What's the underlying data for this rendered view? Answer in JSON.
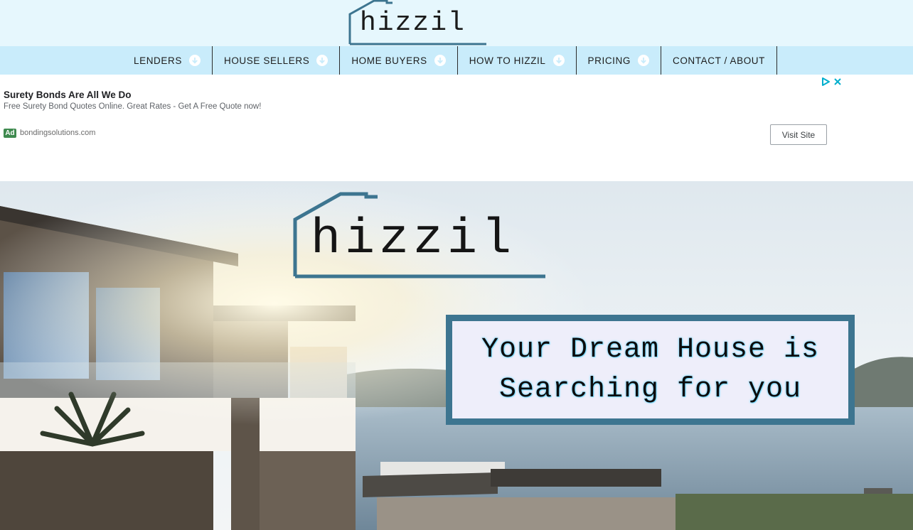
{
  "logo": {
    "text": "hizzil"
  },
  "nav": {
    "items": [
      {
        "label": "LENDERS",
        "has_dropdown": true
      },
      {
        "label": "HOUSE SELLERS",
        "has_dropdown": true
      },
      {
        "label": "HOME BUYERS",
        "has_dropdown": true
      },
      {
        "label": "HOW TO HIZZIL",
        "has_dropdown": true
      },
      {
        "label": "PRICING",
        "has_dropdown": true
      },
      {
        "label": "CONTACT / ABOUT",
        "has_dropdown": false
      }
    ]
  },
  "ad": {
    "title": "Surety Bonds Are All We Do",
    "description": "Free Surety Bond Quotes Online. Great Rates - Get A Free Quote now!",
    "badge": "Ad",
    "domain": "bondingsolutions.com",
    "cta": "Visit Site",
    "icons": [
      "adchoices-icon",
      "close-icon"
    ]
  },
  "hero": {
    "logo_text": "hizzil",
    "tagline": [
      "Your Dream House is",
      "Searching for you"
    ]
  },
  "colors": {
    "header_bg": "#e6f7fd",
    "nav_bg": "#c9ecfb",
    "brand_teal": "#3d7590",
    "ad_badge": "#3f8a4f",
    "ad_choices_blue": "#00aecd"
  }
}
